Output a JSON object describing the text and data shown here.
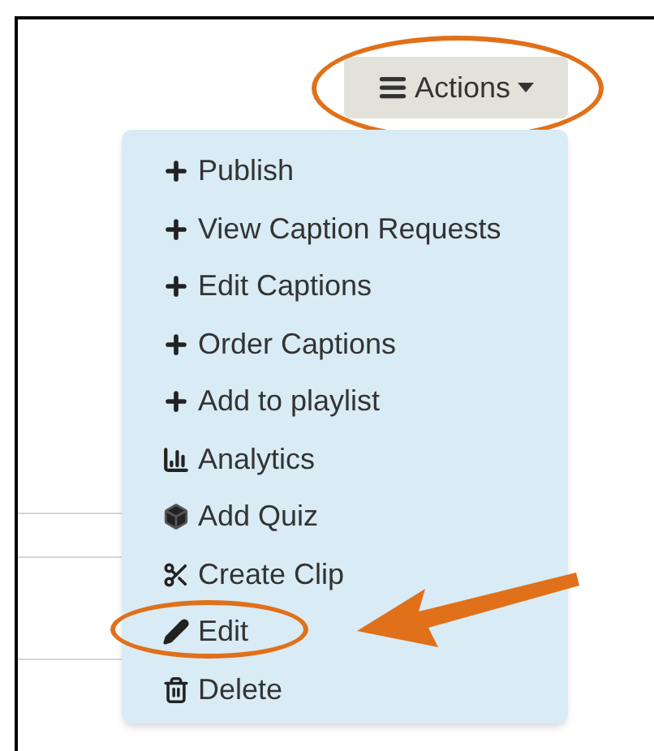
{
  "actions_button": {
    "label": "Actions",
    "circled": true
  },
  "menu": {
    "items": [
      {
        "kind": "plus",
        "label": "Publish",
        "circled": false
      },
      {
        "kind": "plus",
        "label": "View Caption Requests",
        "circled": false
      },
      {
        "kind": "plus",
        "label": "Edit Captions",
        "circled": false
      },
      {
        "kind": "plus",
        "label": "Order Captions",
        "circled": false
      },
      {
        "kind": "plus",
        "label": "Add to playlist",
        "circled": false
      },
      {
        "kind": "chart",
        "label": "Analytics",
        "circled": false
      },
      {
        "kind": "cube",
        "label": "Add Quiz",
        "circled": false
      },
      {
        "kind": "scissors",
        "label": "Create Clip",
        "circled": false
      },
      {
        "kind": "pencil",
        "label": "Edit",
        "circled": true
      },
      {
        "kind": "trash",
        "label": "Delete",
        "circled": false
      }
    ]
  }
}
